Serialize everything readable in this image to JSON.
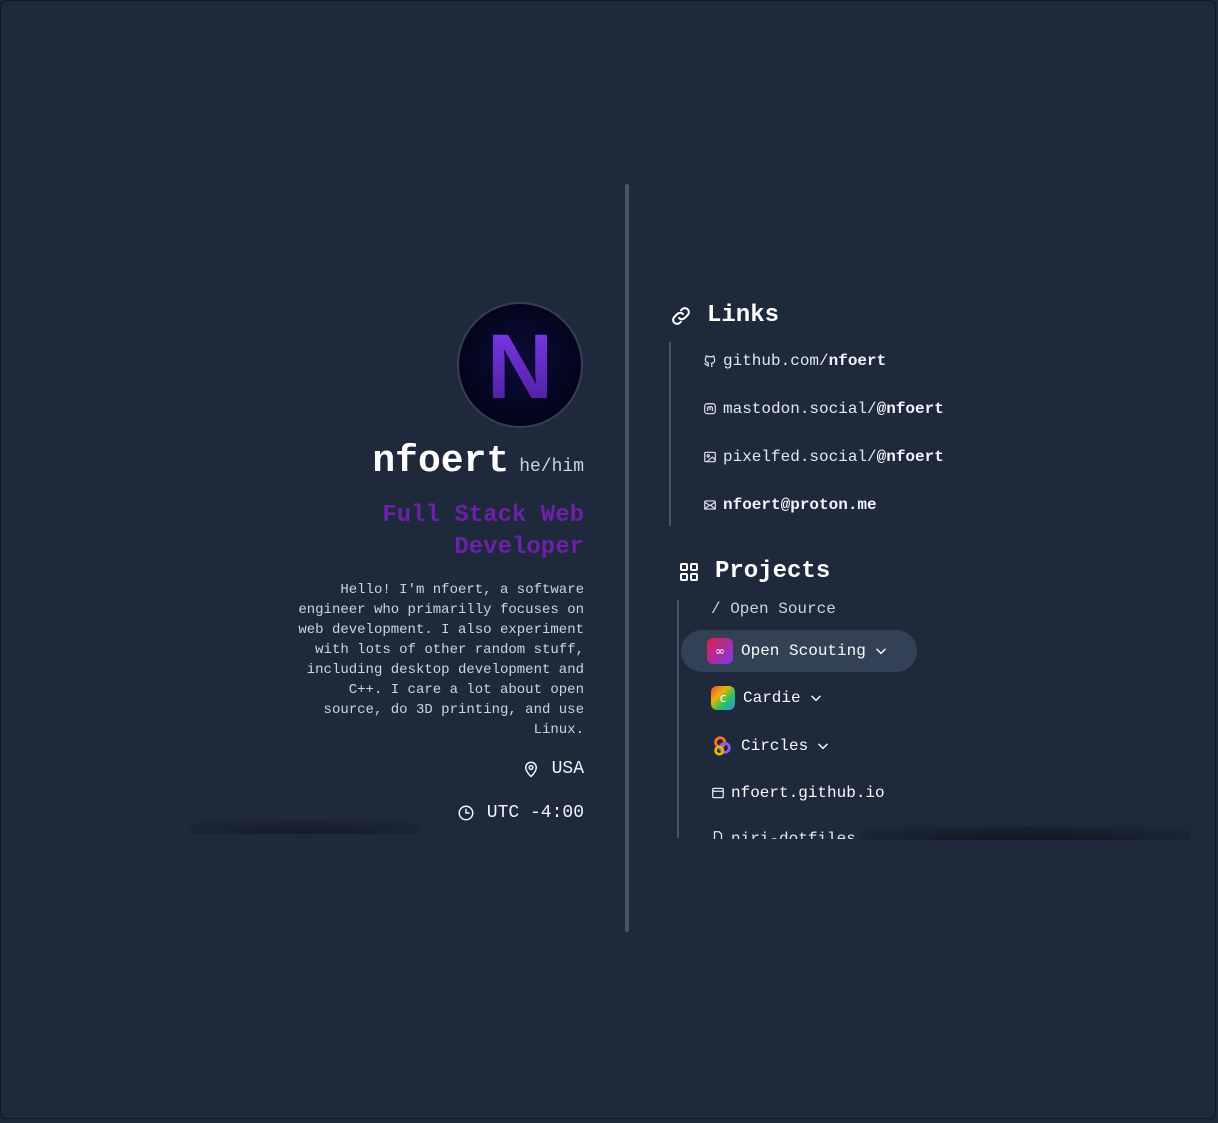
{
  "profile": {
    "avatar_letter": "N",
    "name": "nfoert",
    "pronouns": "he/him",
    "role": "Full Stack Web Developer",
    "bio": "Hello! I'm nfoert, a software engineer who primarilly focuses on web development. I also experiment with lots of other random stuff, including desktop development and C++. I care a lot about open source, do 3D printing, and use Linux.",
    "location": "USA",
    "timezone": "UTC -4:00",
    "location_icon": "map-pin-icon",
    "timezone_icon": "clock-icon"
  },
  "links": {
    "title": "Links",
    "icon": "link-icon",
    "items": [
      {
        "prefix": "github.com/",
        "handle": "nfoert",
        "icon": "github-icon"
      },
      {
        "prefix": "mastodon.social/",
        "handle": "@nfoert",
        "icon": "mastodon-icon"
      },
      {
        "prefix": "pixelfed.social/",
        "handle": "@nfoert",
        "icon": "image-icon"
      },
      {
        "prefix": "",
        "handle": "nfoert@proton.me",
        "icon": "mail-icon"
      }
    ]
  },
  "projects": {
    "title": "Projects",
    "icon": "grid-icon",
    "category": "/ Open Source",
    "items": [
      {
        "label": "Open Scouting",
        "icon": "binoculars-icon",
        "color": "#e11d48",
        "active": true
      },
      {
        "label": "Cardie",
        "icon": "cardie-icon",
        "color": "#22c55e",
        "active": false
      },
      {
        "label": "Circles",
        "icon": "circles-icon",
        "color": "#f97316",
        "active": false
      },
      {
        "label": "nfoert.github.io",
        "icon": "browser-icon",
        "active": false
      },
      {
        "label": "niri-dotfiles",
        "icon": "file-icon",
        "active": false
      }
    ]
  },
  "colors": {
    "background": "#1e293b",
    "accent": "#6b21a8",
    "divider": "#475569"
  }
}
